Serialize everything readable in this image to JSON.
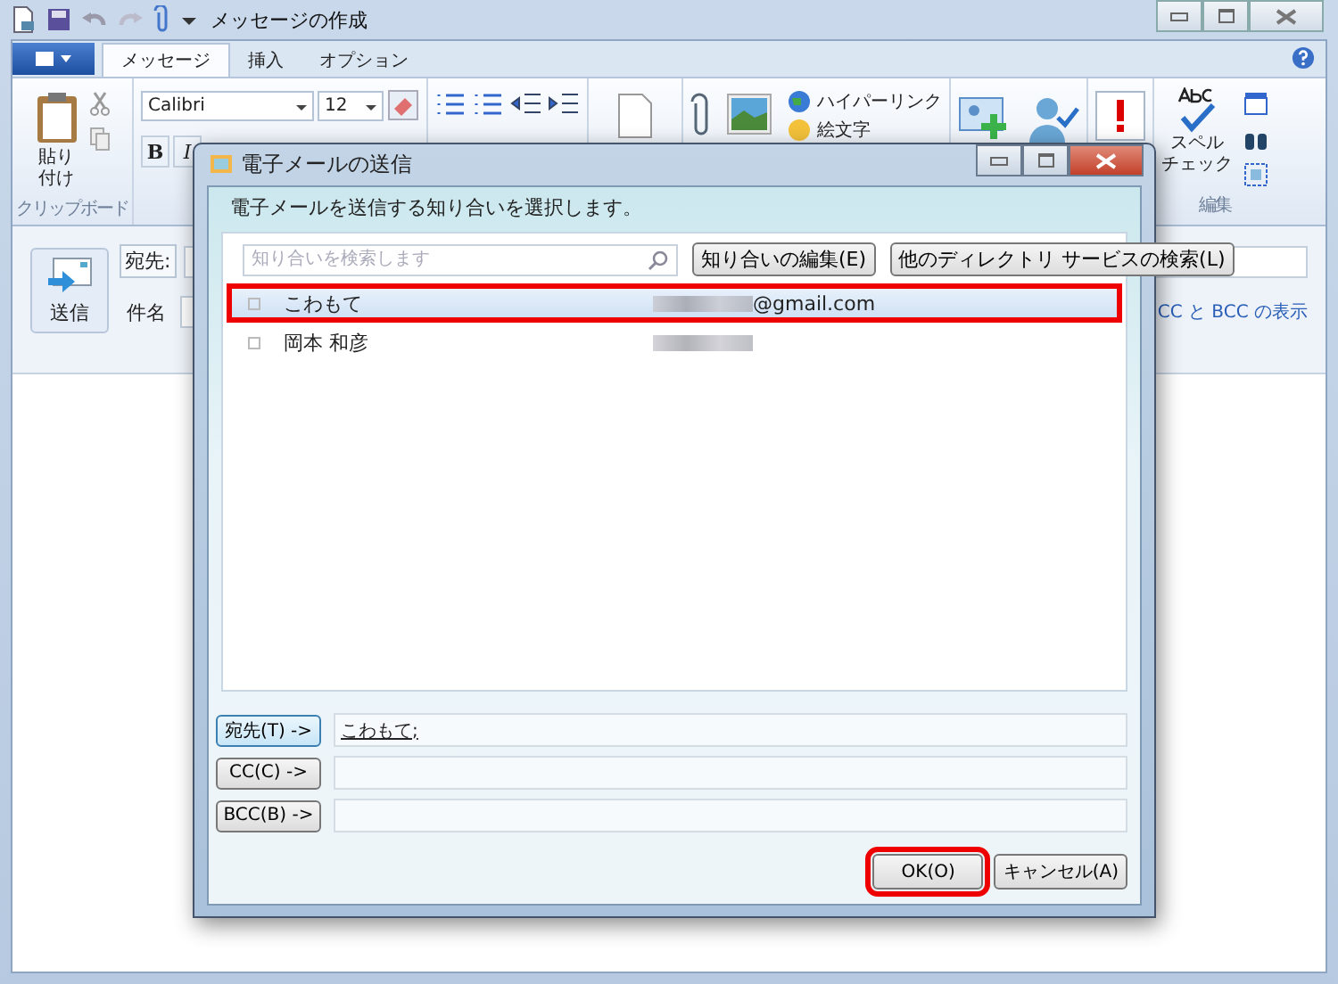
{
  "window": {
    "title": "メッセージの作成"
  },
  "tabs": [
    {
      "label": "メッセージ",
      "selected": true
    },
    {
      "label": "挿入",
      "selected": false
    },
    {
      "label": "オプション",
      "selected": false
    }
  ],
  "ribbon": {
    "paste": "貼り付け",
    "clipboard_group": "クリップボード",
    "font": "Calibri",
    "size": "12",
    "bold": "B",
    "italic": "I",
    "hyperlink": "ハイパーリンク",
    "emoji": "絵文字",
    "spell_check": [
      "スペル",
      "チェック"
    ],
    "edit_group": "編集"
  },
  "compose": {
    "send": "送信",
    "to_label": "宛先:",
    "subject_label": "件名",
    "cc_bcc_link": "CC と BCC の表示"
  },
  "dialog": {
    "title": "電子メールの送信",
    "instruction": "電子メールを送信する知り合いを選択します。",
    "search": {
      "placeholder": "知り合いを検索します"
    },
    "buttons": [
      "知り合いの編集(E)",
      "他のディレクトリ サービスの検索(L)"
    ],
    "contacts": [
      {
        "name": "こわもて",
        "email": "@gmail.com",
        "selected": true,
        "highlighted": true
      },
      {
        "name": "岡本 和彦",
        "selected": false,
        "highlighted": false
      }
    ],
    "recipients": [
      {
        "button": "宛先(T) ->",
        "value": "こわもて;"
      },
      {
        "button": "CC(C) ->"
      },
      {
        "button": "BCC(B) ->"
      }
    ],
    "actions": [
      {
        "label": "OK(O)",
        "highlighted": true
      },
      {
        "label": "キャンセル(A)",
        "highlighted": false
      }
    ]
  }
}
